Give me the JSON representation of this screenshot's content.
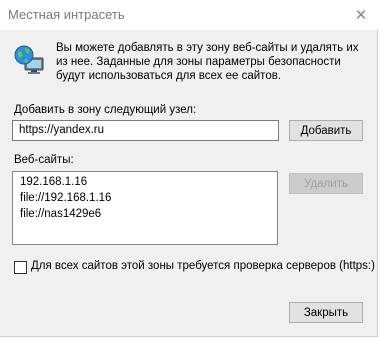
{
  "window": {
    "title": "Местная интрасеть",
    "close_glyph": "✕"
  },
  "info": {
    "text": "Вы можете добавлять в эту зону  веб-сайты и удалять их из нее. Заданные для зоны параметры безопасности будут использоваться для всех ее сайтов."
  },
  "add_section": {
    "label": "Добавить в зону следующий узел:",
    "input_value": "https://yandex.ru",
    "add_button": "Добавить"
  },
  "sites_section": {
    "label": "Веб-сайты:",
    "items": [
      "192.168.1.16",
      "file://192.168.1.16",
      "file://nas1429e6"
    ],
    "remove_button": "Удалить"
  },
  "https_option": {
    "label": "Для всех сайтов этой зоны требуется проверка серверов (https:)",
    "checked": false
  },
  "footer": {
    "close_button": "Закрыть"
  },
  "icons": {
    "window_icon": "globe-computer-icon"
  }
}
